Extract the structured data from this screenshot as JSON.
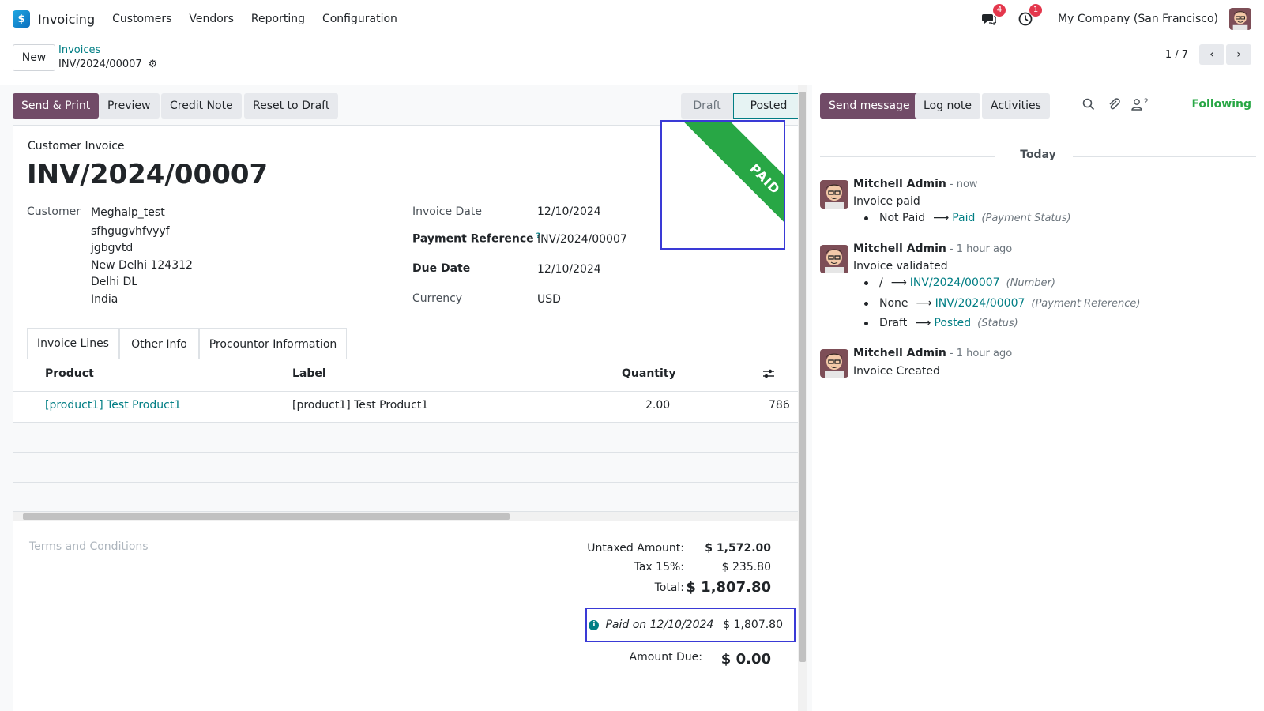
{
  "navbar": {
    "app_name": "Invoicing",
    "menu": [
      "Customers",
      "Vendors",
      "Reporting",
      "Configuration"
    ],
    "messages_count": "4",
    "activities_count": "1",
    "company": "My Company (San Francisco)"
  },
  "control_panel": {
    "new_label": "New",
    "breadcrumb_parent": "Invoices",
    "breadcrumb_current": "INV/2024/00007",
    "pager_value": "1 / 7"
  },
  "actions": {
    "send_print": "Send & Print",
    "preview": "Preview",
    "credit_note": "Credit Note",
    "reset_to_draft": "Reset to Draft"
  },
  "statusbar": {
    "draft": "Draft",
    "posted": "Posted"
  },
  "ribbon": "PAID",
  "invoice": {
    "type": "Customer Invoice",
    "number": "INV/2024/00007",
    "customer_label": "Customer",
    "customer_name": "Meghalp_test",
    "address": [
      "sfhgugvhfvyyf",
      "jgbgvtd",
      "New Delhi 124312",
      "Delhi DL",
      "India"
    ],
    "invoice_date_label": "Invoice Date",
    "invoice_date": "12/10/2024",
    "payment_ref_label": "Payment Reference",
    "payment_ref_help": "?",
    "payment_ref": "INV/2024/00007",
    "due_date_label": "Due Date",
    "due_date": "12/10/2024",
    "currency_label": "Currency",
    "currency": "USD"
  },
  "tabs": [
    "Invoice Lines",
    "Other Info",
    "Procountor Information"
  ],
  "lines": {
    "headers": {
      "product": "Product",
      "label": "Label",
      "quantity": "Quantity"
    },
    "rows": [
      {
        "product": "[product1] Test Product1",
        "label": "[product1] Test Product1",
        "quantity": "2.00",
        "price_partial": "786"
      }
    ]
  },
  "terms_placeholder": "Terms and Conditions",
  "totals": {
    "untaxed_label": "Untaxed Amount:",
    "untaxed": "$ 1,572.00",
    "tax_label": "Tax 15%:",
    "tax": "$ 235.80",
    "total_label": "Total:",
    "total": "$ 1,807.80",
    "paid_on": "Paid on 12/10/2024",
    "paid_amount": "$ 1,807.80",
    "amount_due_label": "Amount Due:",
    "amount_due": "$ 0.00"
  },
  "chatter": {
    "send_message": "Send message",
    "log_note": "Log note",
    "activities": "Activities",
    "followers_count": "2",
    "following": "Following",
    "date_separator": "Today",
    "messages": [
      {
        "author": "Mitchell Admin",
        "time": "- now",
        "body": "Invoice paid",
        "tracking": [
          {
            "old": "Not Paid",
            "new": "Paid",
            "field": "(Payment Status)"
          }
        ]
      },
      {
        "author": "Mitchell Admin",
        "time": "- 1 hour ago",
        "body": "Invoice validated",
        "tracking": [
          {
            "old": "/",
            "new": "INV/2024/00007",
            "field": "(Number)"
          },
          {
            "old": "None",
            "new": "INV/2024/00007",
            "field": "(Payment Reference)"
          },
          {
            "old": "Draft",
            "new": "Posted",
            "field": "(Status)"
          }
        ]
      },
      {
        "author": "Mitchell Admin",
        "time": "- 1 hour ago",
        "body": "Invoice Created",
        "tracking": []
      }
    ]
  },
  "colors": {
    "primary": "#714b67",
    "link": "#017e84",
    "success": "#28a745",
    "badge": "#e4374c"
  }
}
